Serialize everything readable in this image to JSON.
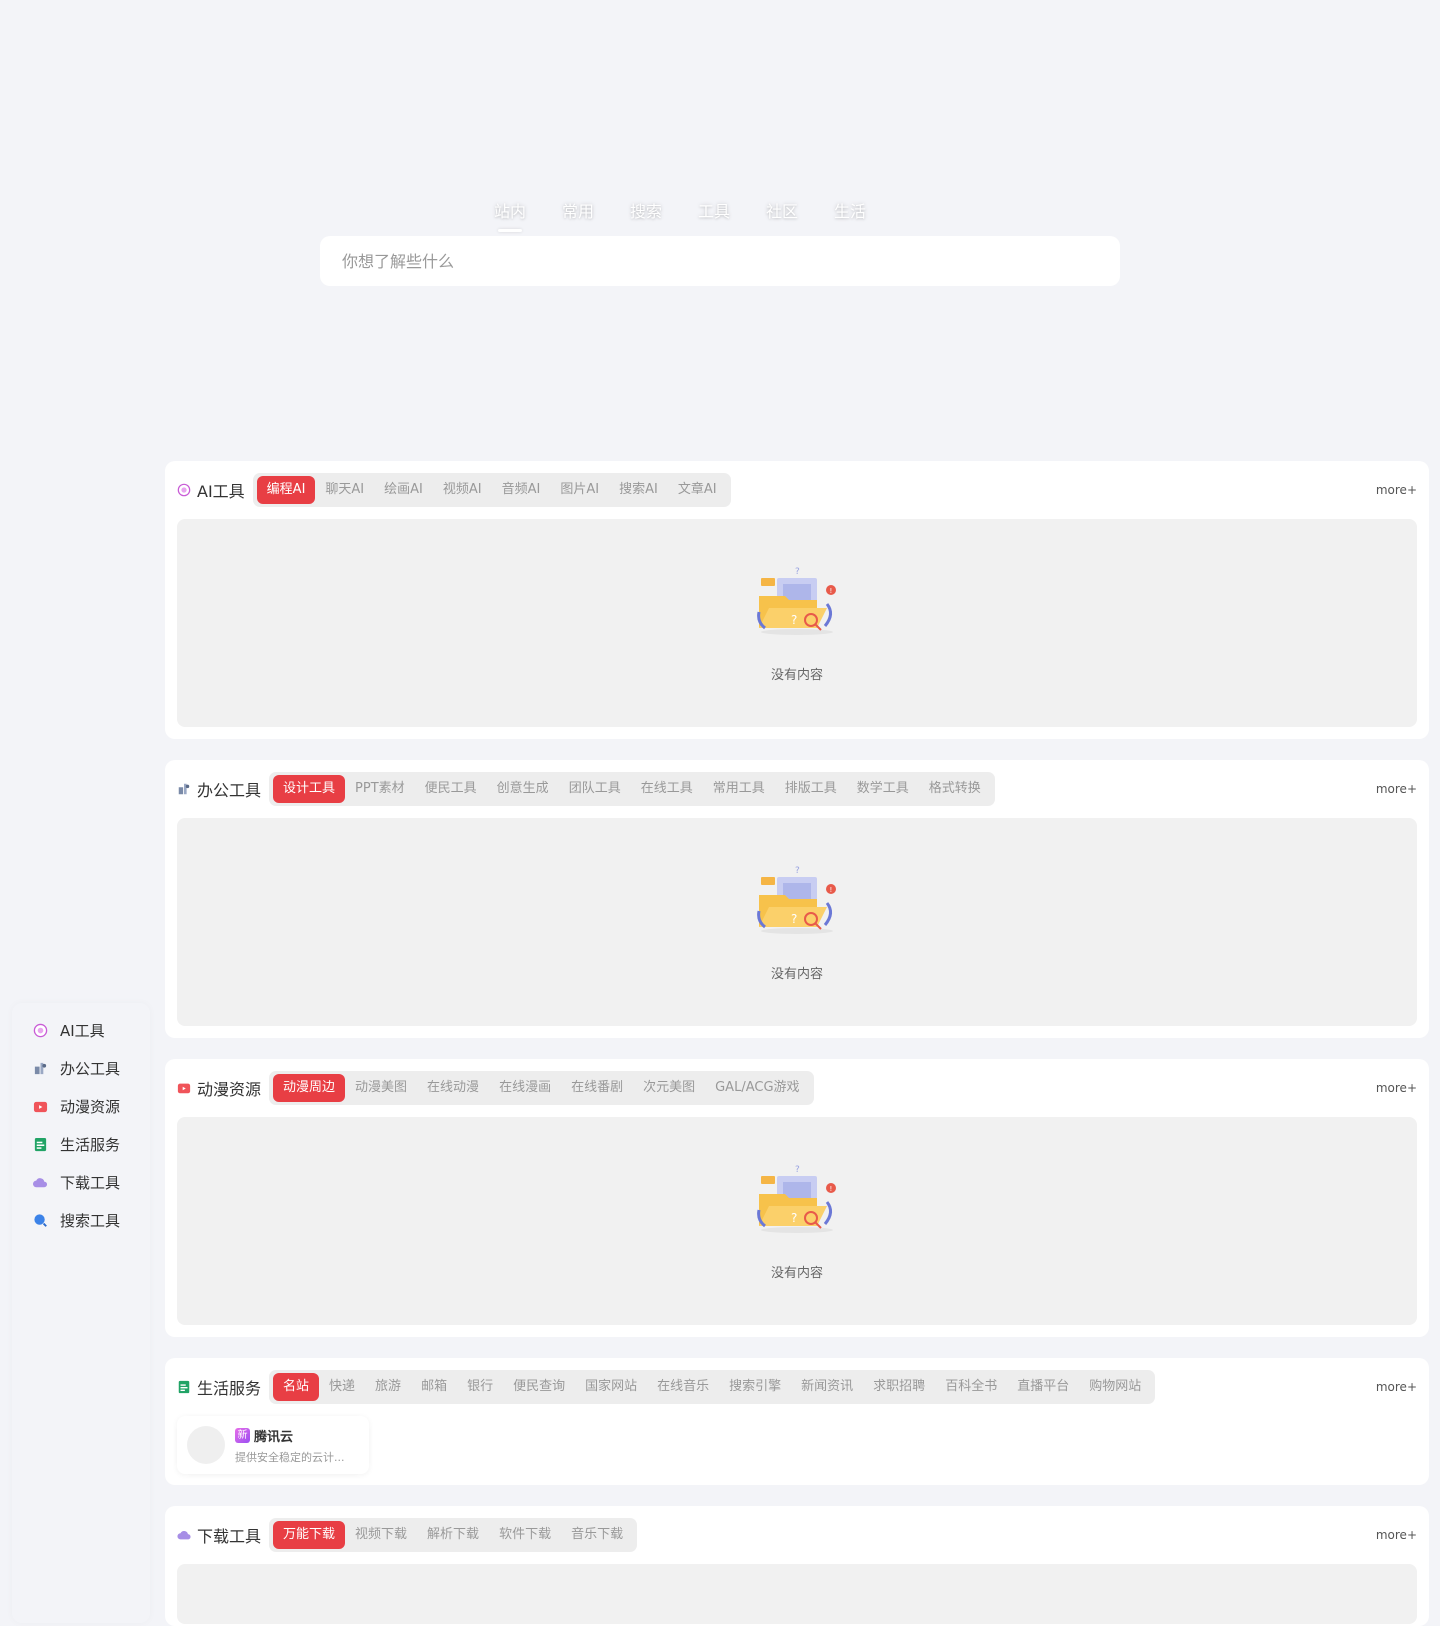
{
  "search": {
    "tabs": [
      "站内",
      "常用",
      "搜索",
      "工具",
      "社区",
      "生活"
    ],
    "active_tab": 0,
    "placeholder": "你想了解些什么"
  },
  "sidebar": {
    "items": [
      {
        "label": "AI工具",
        "icon": "ai-icon"
      },
      {
        "label": "办公工具",
        "icon": "office-icon"
      },
      {
        "label": "动漫资源",
        "icon": "anime-icon"
      },
      {
        "label": "生活服务",
        "icon": "life-icon"
      },
      {
        "label": "下载工具",
        "icon": "cloud-download-icon"
      },
      {
        "label": "搜索工具",
        "icon": "search-icon"
      }
    ]
  },
  "sections": [
    {
      "title": "AI工具",
      "icon": "ai-icon",
      "tabs": [
        "编程AI",
        "聊天AI",
        "绘画AI",
        "视频AI",
        "音频AI",
        "图片AI",
        "搜索AI",
        "文章AI"
      ],
      "active_tab": 0,
      "more": "more+",
      "empty_text": "没有内容"
    },
    {
      "title": "办公工具",
      "icon": "office-icon",
      "tabs": [
        "设计工具",
        "PPT素材",
        "便民工具",
        "创意生成",
        "团队工具",
        "在线工具",
        "常用工具",
        "排版工具",
        "数学工具",
        "格式转换"
      ],
      "active_tab": 0,
      "more": "more+",
      "empty_text": "没有内容"
    },
    {
      "title": "动漫资源",
      "icon": "anime-icon",
      "tabs": [
        "动漫周边",
        "动漫美图",
        "在线动漫",
        "在线漫画",
        "在线番剧",
        "次元美图",
        "GAL/ACG游戏"
      ],
      "active_tab": 0,
      "more": "more+",
      "empty_text": "没有内容"
    },
    {
      "title": "生活服务",
      "icon": "life-icon",
      "tabs": [
        "名站",
        "快递",
        "旅游",
        "邮箱",
        "银行",
        "便民查询",
        "国家网站",
        "在线音乐",
        "搜索引擎",
        "新闻资讯",
        "求职招聘",
        "百科全书",
        "直播平台",
        "购物网站"
      ],
      "active_tab": 0,
      "more": "more+",
      "sites": [
        {
          "badge": "新",
          "name": "腾讯云",
          "desc": "提供安全稳定的云计..."
        }
      ]
    },
    {
      "title": "下载工具",
      "icon": "cloud-download-icon",
      "tabs": [
        "万能下载",
        "视频下载",
        "解析下载",
        "软件下载",
        "音乐下载"
      ],
      "active_tab": 0,
      "more": "more+"
    }
  ],
  "colors": {
    "accent": "#e83e44",
    "page_bg": "#f3f4f8",
    "card_bg": "#ffffff",
    "empty_bg": "#f1f1f1"
  }
}
